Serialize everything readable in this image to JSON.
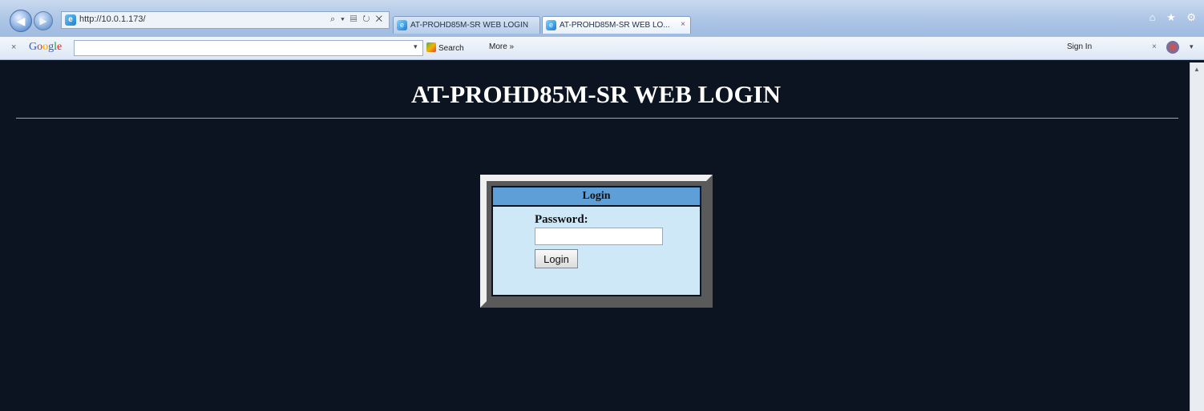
{
  "browser": {
    "url": "http://10.0.1.173/",
    "address_tools": "⌕ ▾ ▤ ↻ ✕",
    "tabs": [
      {
        "label": "AT-PROHD85M-SR WEB LOGIN"
      },
      {
        "label": "AT-PROHD85M-SR WEB LO...",
        "close": "×"
      }
    ],
    "toolbar": {
      "close": "×",
      "google_logo": [
        "G",
        "o",
        "o",
        "g",
        "l",
        "e"
      ],
      "search_label": "Search",
      "search_dropdown": "▾",
      "more_label": "More »",
      "signin_label": "Sign In",
      "right_close": "×",
      "right_dropdown": "▾"
    },
    "icons": [
      "back-arrow-icon",
      "forward-arrow-icon",
      "home-icon",
      "star-icon",
      "gear-icon"
    ]
  },
  "page": {
    "title": "AT-PROHD85M-SR WEB LOGIN",
    "login_panel": {
      "header": "Login",
      "password_label": "Password:",
      "password_value": "",
      "button_label": "Login"
    }
  },
  "colors": {
    "page_background": "#0b1420",
    "panel_background": "#cfe8f8",
    "panel_header": "#5e9fd8"
  }
}
